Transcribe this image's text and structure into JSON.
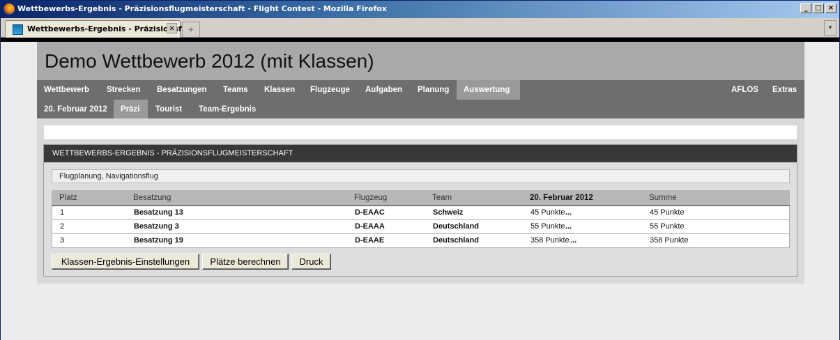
{
  "window": {
    "title": "Wettbewerbs-Ergebnis - Präzisionsflugmeisterschaft - Flight Contest - Mozilla Firefox",
    "controls": {
      "minimize": "_",
      "maximize": "□",
      "close": "×"
    }
  },
  "browser": {
    "tab_title": "Wettbewerbs-Ergebnis - Präzisionsfl...",
    "tab_close": "×",
    "new_tab": "+",
    "tab_list": "▾"
  },
  "site": {
    "title": "Demo Wettbewerb 2012 (mit Klassen)"
  },
  "nav": {
    "main": [
      {
        "label": "Wettbewerb",
        "active": false
      },
      {
        "label": "Strecken",
        "active": false
      },
      {
        "label": "Besatzungen",
        "active": false
      },
      {
        "label": "Teams",
        "active": false
      },
      {
        "label": "Klassen",
        "active": false
      },
      {
        "label": "Flugzeuge",
        "active": false
      },
      {
        "label": "Aufgaben",
        "active": false
      },
      {
        "label": "Planung",
        "active": false
      },
      {
        "label": "Auswertung",
        "active": true
      }
    ],
    "right": [
      {
        "label": "AFLOS"
      },
      {
        "label": "Extras"
      }
    ],
    "sub": [
      {
        "label": "20. Februar 2012",
        "active": false
      },
      {
        "label": "Präzi",
        "active": true
      },
      {
        "label": "Tourist",
        "active": false
      },
      {
        "label": "Team-Ergebnis",
        "active": false
      }
    ]
  },
  "panel": {
    "title": "WETTBEWERBS-ERGEBNIS - PRÄZISIONSFLUGMEISTERSCHAFT",
    "subtitle": "Flugplanung, Navigationsflug"
  },
  "table": {
    "headers": [
      "Platz",
      "Besatzung",
      "Flugzeug",
      "Team",
      "20. Februar 2012",
      "Summe"
    ],
    "rows": [
      {
        "platz": "1",
        "besatzung": "Besatzung 13",
        "flugzeug": "D-EAAC",
        "team": "Schweiz",
        "wertung": "45 Punkte",
        "more": "...",
        "summe": "45 Punkte"
      },
      {
        "platz": "2",
        "besatzung": "Besatzung 3",
        "flugzeug": "D-EAAA",
        "team": "Deutschland",
        "wertung": "55 Punkte",
        "more": "...",
        "summe": "55 Punkte"
      },
      {
        "platz": "3",
        "besatzung": "Besatzung 19",
        "flugzeug": "D-EAAE",
        "team": "Deutschland",
        "wertung": "358 Punkte",
        "more": "...",
        "summe": "358 Punkte"
      }
    ]
  },
  "buttons": {
    "class_settings": "Klassen-Ergebnis-Einstellungen",
    "calculate": "Plätze berechnen",
    "print": "Druck"
  },
  "colors": {
    "titlebar": "#0a246a",
    "nav_bg": "#6e6e6e",
    "nav_active": "#9a9a9a",
    "panel_header": "#383838"
  }
}
